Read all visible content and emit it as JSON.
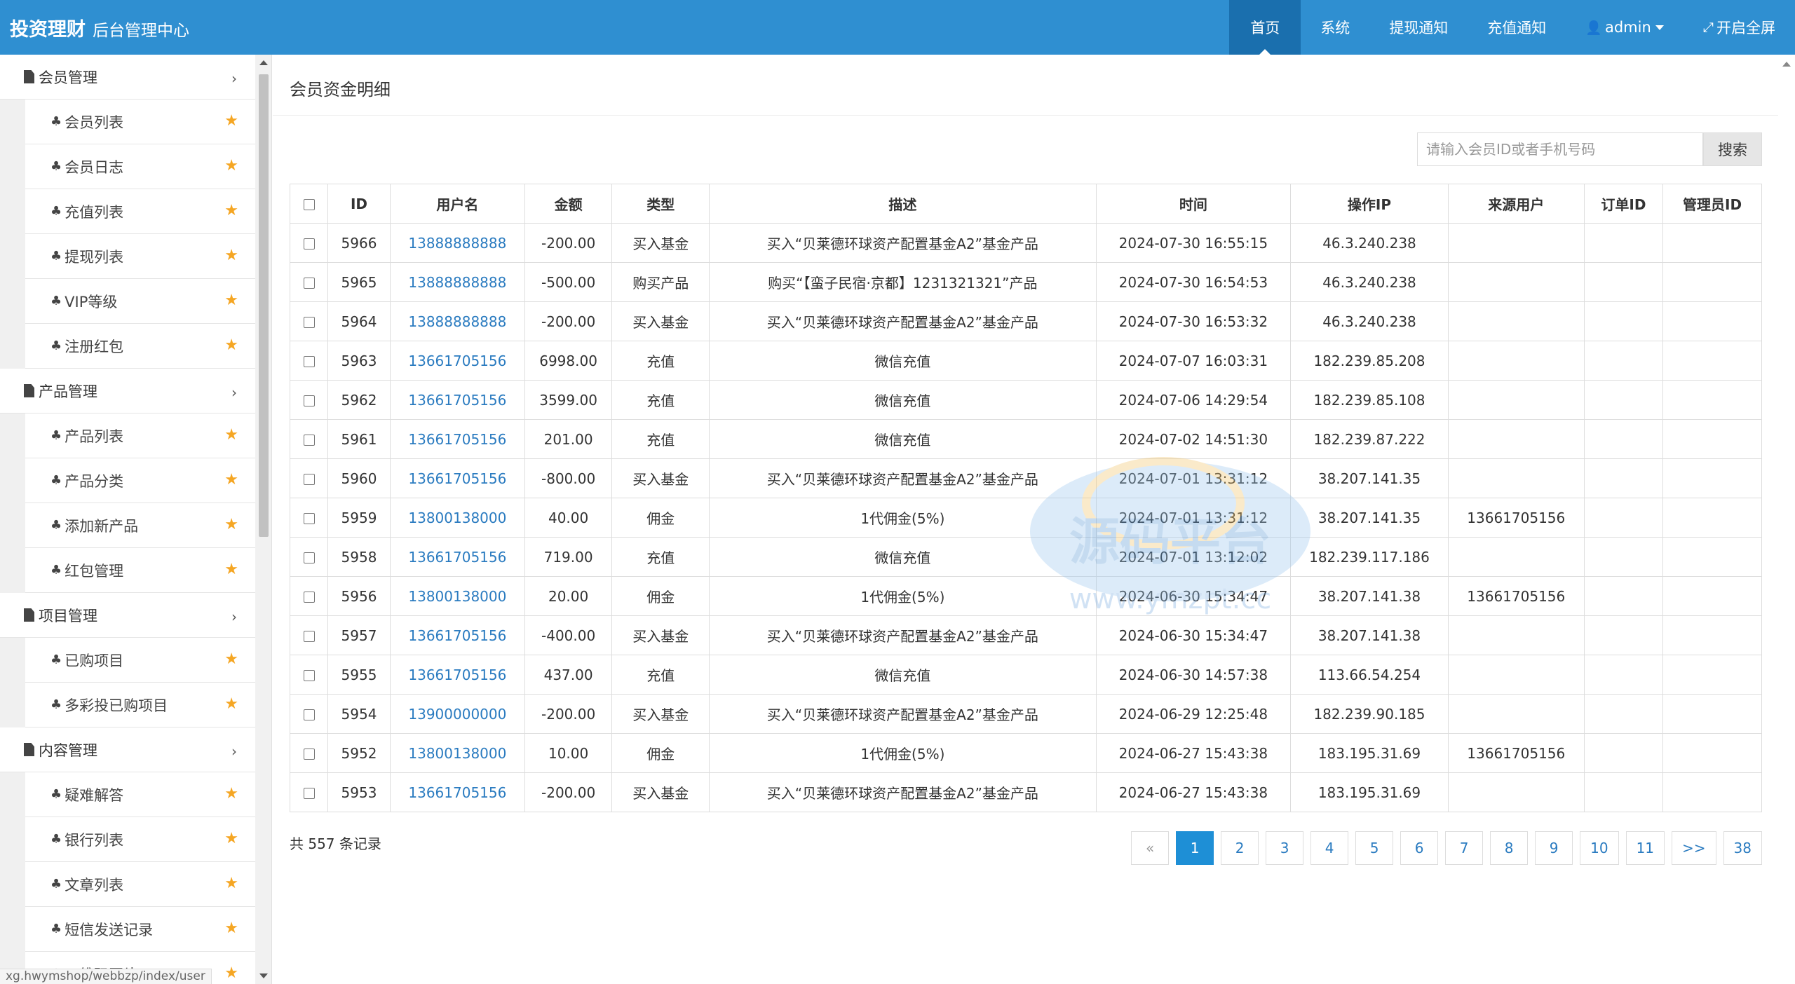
{
  "brand": {
    "main": "投资理财",
    "sub": "后台管理中心"
  },
  "topnav": [
    {
      "label": "首页",
      "active": true
    },
    {
      "label": "系统"
    },
    {
      "label": "提现通知"
    },
    {
      "label": "充值通知"
    },
    {
      "label": "admin",
      "icon": "user-icon"
    },
    {
      "label": "开启全屏",
      "icon": "fullscreen-icon"
    }
  ],
  "sidebar": {
    "groups": [
      {
        "title": "会员管理",
        "items": [
          "会员列表",
          "会员日志",
          "充值列表",
          "提现列表",
          "VIP等级",
          "注册红包"
        ]
      },
      {
        "title": "产品管理",
        "items": [
          "产品列表",
          "产品分类",
          "添加新产品",
          "红包管理"
        ]
      },
      {
        "title": "项目管理",
        "items": [
          "已购项目",
          "多彩投已购项目"
        ]
      },
      {
        "title": "内容管理",
        "items": [
          "疑难解答",
          "银行列表",
          "文章列表",
          "短信发送记录",
          "二维码图片"
        ]
      }
    ]
  },
  "status_url": "xg.hwymshop/webbzp/index/user",
  "main": {
    "title": "会员资金明细",
    "search": {
      "placeholder": "请输入会员ID或者手机号码",
      "button": "搜索"
    },
    "table": {
      "headers": [
        "",
        "ID",
        "用户名",
        "金额",
        "类型",
        "描述",
        "时间",
        "操作IP",
        "来源用户",
        "订单ID",
        "管理员ID"
      ],
      "rows": [
        [
          "5966",
          "13888888888",
          "-200.00",
          "买入基金",
          "买入“贝莱德环球资产配置基金A2”基金产品",
          "2024-07-30 16:55:15",
          "46.3.240.238",
          "",
          "",
          ""
        ],
        [
          "5965",
          "13888888888",
          "-500.00",
          "购买产品",
          "购买“【蛮子民宿·京都】1231321321”产品",
          "2024-07-30 16:54:53",
          "46.3.240.238",
          "",
          "",
          ""
        ],
        [
          "5964",
          "13888888888",
          "-200.00",
          "买入基金",
          "买入“贝莱德环球资产配置基金A2”基金产品",
          "2024-07-30 16:53:32",
          "46.3.240.238",
          "",
          "",
          ""
        ],
        [
          "5963",
          "13661705156",
          "6998.00",
          "充值",
          "微信充值",
          "2024-07-07 16:03:31",
          "182.239.85.208",
          "",
          "",
          ""
        ],
        [
          "5962",
          "13661705156",
          "3599.00",
          "充值",
          "微信充值",
          "2024-07-06 14:29:54",
          "182.239.85.108",
          "",
          "",
          ""
        ],
        [
          "5961",
          "13661705156",
          "201.00",
          "充值",
          "微信充值",
          "2024-07-02 14:51:30",
          "182.239.87.222",
          "",
          "",
          ""
        ],
        [
          "5960",
          "13661705156",
          "-800.00",
          "买入基金",
          "买入“贝莱德环球资产配置基金A2”基金产品",
          "2024-07-01 13:31:12",
          "38.207.141.35",
          "",
          "",
          ""
        ],
        [
          "5959",
          "13800138000",
          "40.00",
          "佣金",
          "1代佣金(5%)",
          "2024-07-01 13:31:12",
          "38.207.141.35",
          "13661705156",
          "",
          ""
        ],
        [
          "5958",
          "13661705156",
          "719.00",
          "充值",
          "微信充值",
          "2024-07-01 13:12:02",
          "182.239.117.186",
          "",
          "",
          ""
        ],
        [
          "5956",
          "13800138000",
          "20.00",
          "佣金",
          "1代佣金(5%)",
          "2024-06-30 15:34:47",
          "38.207.141.38",
          "13661705156",
          "",
          ""
        ],
        [
          "5957",
          "13661705156",
          "-400.00",
          "买入基金",
          "买入“贝莱德环球资产配置基金A2”基金产品",
          "2024-06-30 15:34:47",
          "38.207.141.38",
          "",
          "",
          ""
        ],
        [
          "5955",
          "13661705156",
          "437.00",
          "充值",
          "微信充值",
          "2024-06-30 14:57:38",
          "113.66.54.254",
          "",
          "",
          ""
        ],
        [
          "5954",
          "13900000000",
          "-200.00",
          "买入基金",
          "买入“贝莱德环球资产配置基金A2”基金产品",
          "2024-06-29 12:25:48",
          "182.239.90.185",
          "",
          "",
          ""
        ],
        [
          "5952",
          "13800138000",
          "10.00",
          "佣金",
          "1代佣金(5%)",
          "2024-06-27 15:43:38",
          "183.195.31.69",
          "13661705156",
          "",
          ""
        ],
        [
          "5953",
          "13661705156",
          "-200.00",
          "买入基金",
          "买入“贝莱德环球资产配置基金A2”基金产品",
          "2024-06-27 15:43:38",
          "183.195.31.69",
          "",
          "",
          ""
        ]
      ]
    },
    "total": "共 557 条记录",
    "pagination": [
      "«",
      "1",
      "2",
      "3",
      "4",
      "5",
      "6",
      "7",
      "8",
      "9",
      "10",
      "11",
      ">>",
      "38"
    ],
    "current_page": "1"
  },
  "watermark": {
    "main": "源码平台",
    "sub": "www.ymzpt.cc"
  },
  "colors": {
    "header": "#2f8fd1",
    "header_active": "#1a6fae",
    "link": "#2a7bc0",
    "star": "#f5a623",
    "page_active": "#1e8fd6"
  }
}
